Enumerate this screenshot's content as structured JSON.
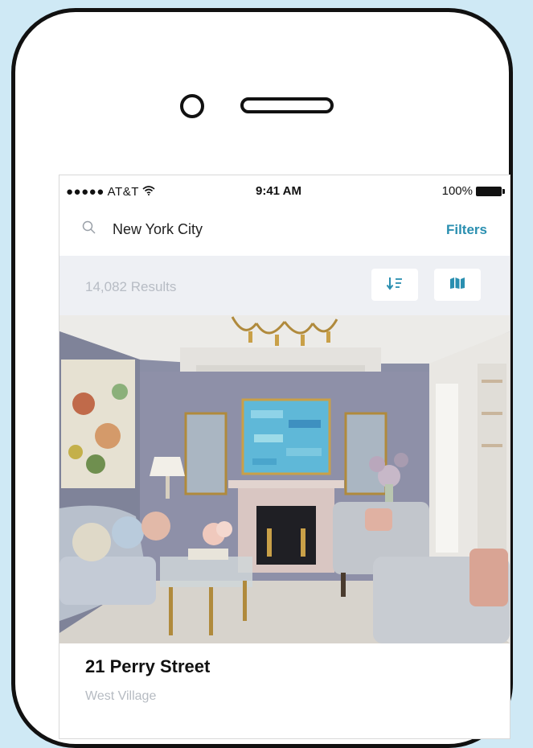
{
  "status_bar": {
    "carrier": "●●●●● AT&T",
    "time": "9:41 AM",
    "battery": "100%"
  },
  "search": {
    "location": "New York City",
    "filters_label": "Filters"
  },
  "results": {
    "count_text": "14,082 Results"
  },
  "listing": {
    "title": "21 Perry Street",
    "neighborhood": "West Village"
  },
  "colors": {
    "accent": "#2a8fb0",
    "background": "#cfe9f5",
    "toolbar": "#eef0f4",
    "muted_text": "#b7bcc4"
  },
  "icons": {
    "search": "search-icon",
    "wifi": "wifi-icon",
    "battery": "battery-icon",
    "sort": "sort-icon",
    "map": "map-icon"
  }
}
